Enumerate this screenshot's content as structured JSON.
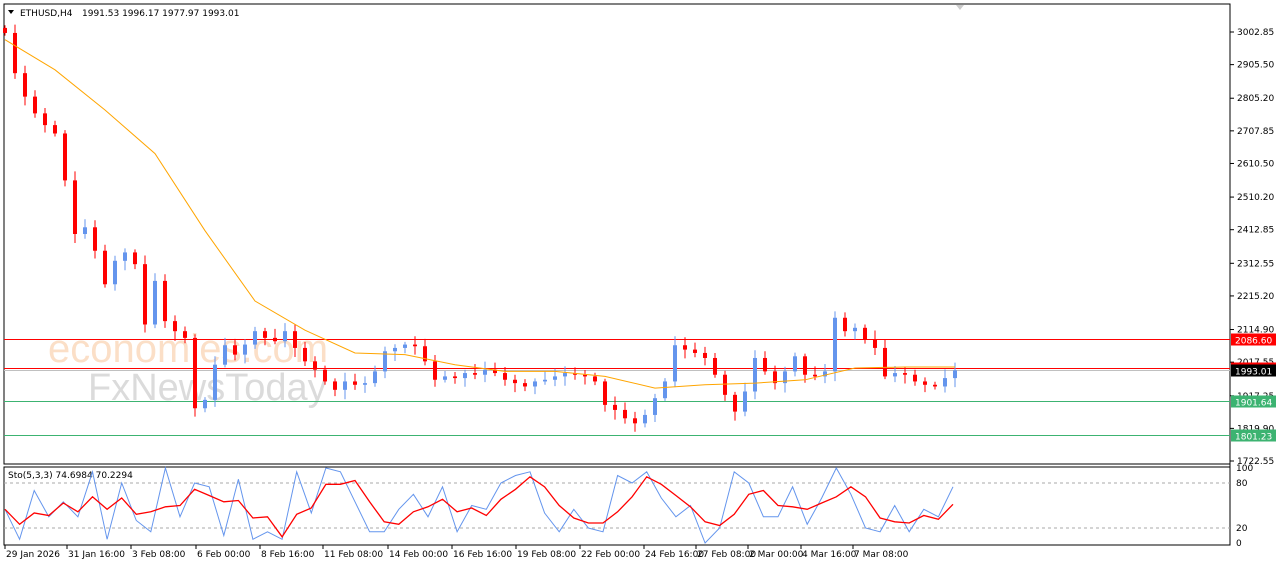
{
  "header": {
    "symbol": "ETHUSD,H4",
    "ohlc": "1991.53 1996.17 1977.97 1993.01"
  },
  "watermark": {
    "line1": "economies.com",
    "line2": "FxNewsToday"
  },
  "colors": {
    "bull": "#6495ed",
    "bear": "#ff0000",
    "ma": "#ffa500",
    "resistance": "#ff0000",
    "support": "#3cb371",
    "stoch_main": "#6495ed",
    "stoch_signal": "#ff0000"
  },
  "chart_data": [
    {
      "type": "candlestick",
      "title": "ETHUSD,H4",
      "ylim": [
        1722.55,
        3002.85
      ],
      "y_ticks": [
        "3002.85",
        "2905.50",
        "2805.20",
        "2707.85",
        "2610.50",
        "2510.20",
        "2412.85",
        "2312.55",
        "2215.20",
        "2114.90",
        "2017.55",
        "1917.25",
        "1819.90",
        "1722.55"
      ],
      "x_ticks": [
        "29 Jan 2026",
        "31 Jan 16:00",
        "3 Feb 08:00",
        "6 Feb 00:00",
        "8 Feb 16:00",
        "11 Feb 08:00",
        "14 Feb 00:00",
        "16 Feb 16:00",
        "19 Feb 08:00",
        "22 Feb 00:00",
        "24 Feb 16:00",
        "27 Feb 08:00",
        "2 Mar 00:00",
        "4 Mar 16:00",
        "7 Mar 08:00"
      ],
      "closes": [
        3000,
        2880,
        2810,
        2760,
        2725,
        2700,
        2560,
        2400,
        2420,
        2350,
        2250,
        2320,
        2345,
        2310,
        2130,
        2260,
        2140,
        2110,
        2090,
        1880,
        1905,
        2010,
        2068,
        2040,
        2070,
        2110,
        2090,
        2080,
        2110,
        2060,
        2020,
        1995,
        1960,
        1935,
        1960,
        1950,
        1955,
        1990,
        2050,
        2060,
        2070,
        2065,
        2020,
        1965,
        1975,
        1970,
        1985,
        1980,
        1995,
        1985,
        1965,
        1955,
        1945,
        1960,
        1965,
        1975,
        1985,
        1980,
        1975,
        1960,
        1890,
        1875,
        1850,
        1835,
        1860,
        1910,
        1960,
        2068,
        2055,
        2045,
        2030,
        1980,
        1920,
        1870,
        1930,
        2030,
        1990,
        1955,
        1990,
        2035,
        1980,
        1975,
        1990,
        2150,
        2110,
        2120,
        2085,
        2060,
        1975,
        1985,
        1980,
        1960,
        1950,
        1945,
        1970,
        1993
      ],
      "moving_average": [
        2980,
        2890,
        2770,
        2640,
        2410,
        2200,
        2113,
        2045,
        2040,
        2010,
        1990,
        1990,
        1975,
        1940,
        1950,
        1955,
        1965,
        2000,
        2003,
        2003
      ],
      "levels": [
        {
          "label": "2086.60",
          "value": 2086.6,
          "kind": "resistance"
        },
        {
          "label": "2001.57",
          "value": 2001.57,
          "kind": "resistance"
        },
        {
          "label": "1993.01",
          "value": 1993.01,
          "kind": "current"
        },
        {
          "label": "1901.64",
          "value": 1901.64,
          "kind": "support"
        },
        {
          "label": "1801.23",
          "value": 1801.23,
          "kind": "support"
        }
      ]
    },
    {
      "type": "line",
      "title": "Sto(5,3,3) 74.6984 70.2294",
      "ylim": [
        0,
        100
      ],
      "y_ticks": [
        "100",
        "80",
        "20",
        "0"
      ],
      "levels": [
        80,
        20
      ],
      "main": [
        45,
        5,
        70,
        35,
        55,
        35,
        95,
        5,
        80,
        30,
        15,
        100,
        35,
        80,
        75,
        10,
        85,
        5,
        15,
        5,
        95,
        40,
        100,
        95,
        55,
        15,
        15,
        45,
        65,
        35,
        75,
        15,
        50,
        45,
        80,
        90,
        95,
        40,
        15,
        45,
        20,
        15,
        90,
        80,
        95,
        60,
        35,
        50,
        0,
        20,
        95,
        80,
        35,
        35,
        75,
        25,
        60,
        100,
        65,
        20,
        15,
        50,
        15,
        45,
        35,
        75
      ]
    }
  ]
}
